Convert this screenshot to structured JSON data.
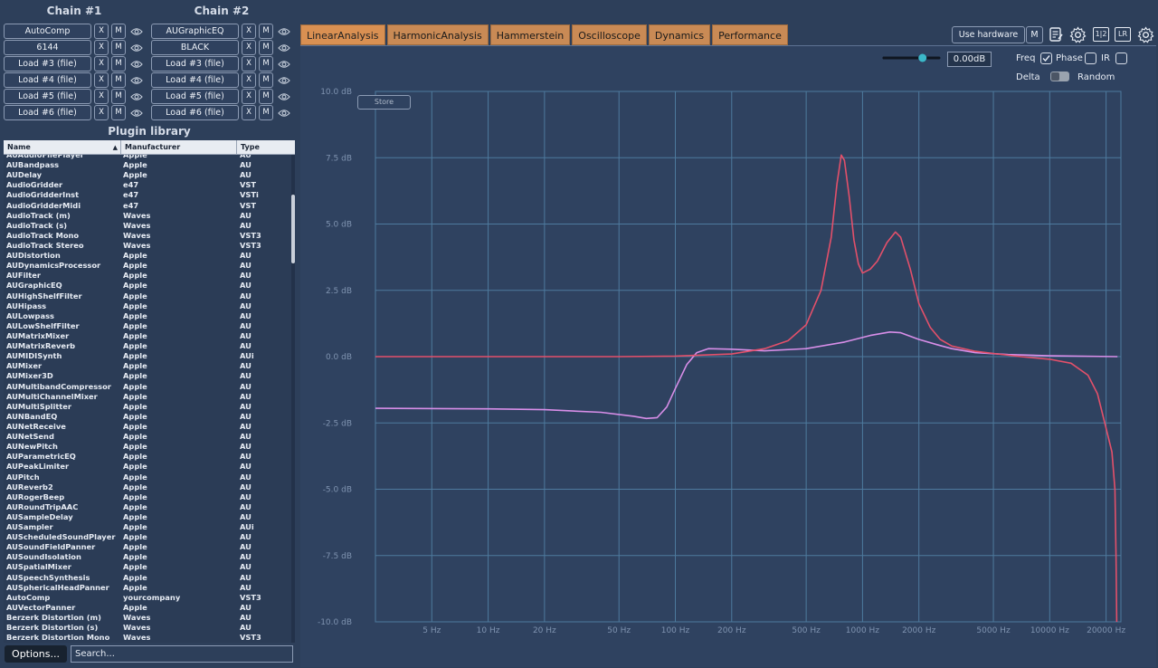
{
  "chains": [
    {
      "title": "Chain #1",
      "slots": [
        "AutoComp",
        "6144",
        "Load #3 (file)",
        "Load #4 (file)",
        "Load #5 (file)",
        "Load #6 (file)"
      ]
    },
    {
      "title": "Chain #2",
      "slots": [
        "AUGraphicEQ",
        "BLACK",
        "Load #3 (file)",
        "Load #4 (file)",
        "Load #5 (file)",
        "Load #6 (file)"
      ]
    }
  ],
  "slot_buttons": {
    "remove": "X",
    "mute": "M",
    "view_icon": "eye-icon"
  },
  "library": {
    "title": "Plugin library",
    "columns": [
      "Name",
      "Manufacturer",
      "Type"
    ],
    "rows": [
      [
        "AUAudioFilePlayer",
        "Apple",
        "AU"
      ],
      [
        "AUBandpass",
        "Apple",
        "AU"
      ],
      [
        "AUDelay",
        "Apple",
        "AU"
      ],
      [
        "AudioGridder",
        "e47",
        "VST"
      ],
      [
        "AudioGridderInst",
        "e47",
        "VSTi"
      ],
      [
        "AudioGridderMidi",
        "e47",
        "VST"
      ],
      [
        "AudioTrack (m)",
        "Waves",
        "AU"
      ],
      [
        "AudioTrack (s)",
        "Waves",
        "AU"
      ],
      [
        "AudioTrack Mono",
        "Waves",
        "VST3"
      ],
      [
        "AudioTrack Stereo",
        "Waves",
        "VST3"
      ],
      [
        "AUDistortion",
        "Apple",
        "AU"
      ],
      [
        "AUDynamicsProcessor",
        "Apple",
        "AU"
      ],
      [
        "AUFilter",
        "Apple",
        "AU"
      ],
      [
        "AUGraphicEQ",
        "Apple",
        "AU"
      ],
      [
        "AUHighShelfFilter",
        "Apple",
        "AU"
      ],
      [
        "AUHipass",
        "Apple",
        "AU"
      ],
      [
        "AULowpass",
        "Apple",
        "AU"
      ],
      [
        "AULowShelfFilter",
        "Apple",
        "AU"
      ],
      [
        "AUMatrixMixer",
        "Apple",
        "AU"
      ],
      [
        "AUMatrixReverb",
        "Apple",
        "AU"
      ],
      [
        "AUMIDISynth",
        "Apple",
        "AUi"
      ],
      [
        "AUMixer",
        "Apple",
        "AU"
      ],
      [
        "AUMixer3D",
        "Apple",
        "AU"
      ],
      [
        "AUMultibandCompressor",
        "Apple",
        "AU"
      ],
      [
        "AUMultiChannelMixer",
        "Apple",
        "AU"
      ],
      [
        "AUMultiSplitter",
        "Apple",
        "AU"
      ],
      [
        "AUNBandEQ",
        "Apple",
        "AU"
      ],
      [
        "AUNetReceive",
        "Apple",
        "AU"
      ],
      [
        "AUNetSend",
        "Apple",
        "AU"
      ],
      [
        "AUNewPitch",
        "Apple",
        "AU"
      ],
      [
        "AUParametricEQ",
        "Apple",
        "AU"
      ],
      [
        "AUPeakLimiter",
        "Apple",
        "AU"
      ],
      [
        "AUPitch",
        "Apple",
        "AU"
      ],
      [
        "AUReverb2",
        "Apple",
        "AU"
      ],
      [
        "AURogerBeep",
        "Apple",
        "AU"
      ],
      [
        "AURoundTripAAC",
        "Apple",
        "AU"
      ],
      [
        "AUSampleDelay",
        "Apple",
        "AU"
      ],
      [
        "AUSampler",
        "Apple",
        "AUi"
      ],
      [
        "AUScheduledSoundPlayer",
        "Apple",
        "AU"
      ],
      [
        "AUSoundFieldPanner",
        "Apple",
        "AU"
      ],
      [
        "AUSoundIsolation",
        "Apple",
        "AU"
      ],
      [
        "AUSpatialMixer",
        "Apple",
        "AU"
      ],
      [
        "AUSpeechSynthesis",
        "Apple",
        "AU"
      ],
      [
        "AUSphericalHeadPanner",
        "Apple",
        "AU"
      ],
      [
        "AutoComp",
        "yourcompany",
        "VST3"
      ],
      [
        "AUVectorPanner",
        "Apple",
        "AU"
      ],
      [
        "Berzerk Distortion (m)",
        "Waves",
        "AU"
      ],
      [
        "Berzerk Distortion (s)",
        "Waves",
        "AU"
      ],
      [
        "Berzerk Distortion Mono",
        "Waves",
        "VST3"
      ]
    ]
  },
  "bottom": {
    "options_label": "Options...",
    "search_placeholder": "Search..."
  },
  "tabs": [
    "LinearAnalysis",
    "HarmonicAnalysis",
    "Hammerstein",
    "Oscilloscope",
    "Dynamics",
    "Performance"
  ],
  "active_tab": "LinearAnalysis",
  "toolbar": {
    "use_hardware_label": "Use hardware",
    "m_label": "M",
    "stereo_icon_label": "1|2",
    "lr_icon_label": "LR",
    "icons": [
      "notes-icon",
      "gear-icon",
      "channels-icon",
      "lr-icon",
      "settings-gear-icon"
    ]
  },
  "controls": {
    "gain_value": "0.00dB",
    "gain_level": 0.7,
    "freq_label": "Freq",
    "freq_checked": true,
    "phase_label": "Phase",
    "phase_checked": false,
    "ir_label": "IR",
    "ir_checked": false,
    "delta_label": "Delta",
    "delta_on": false,
    "random_label": "Random",
    "store_label": "Store"
  },
  "colors": {
    "background": "#2d3f5a",
    "plot_background": "#2f4260",
    "grid": "#4e7a9e",
    "tab": "#c98a55",
    "accent": "#3bb8c9",
    "curve_magnitude": "#e3506a",
    "curve_phase": "#d88ee8"
  },
  "chart_data": {
    "type": "line",
    "xscale": "log",
    "xlim": [
      2.5,
      24000
    ],
    "ylim": [
      -10,
      10
    ],
    "x_ticks": [
      {
        "value": 5,
        "label": "5 Hz"
      },
      {
        "value": 10,
        "label": "10 Hz"
      },
      {
        "value": 20,
        "label": "20 Hz"
      },
      {
        "value": 50,
        "label": "50 Hz"
      },
      {
        "value": 100,
        "label": "100 Hz"
      },
      {
        "value": 200,
        "label": "200 Hz"
      },
      {
        "value": 500,
        "label": "500 Hz"
      },
      {
        "value": 1000,
        "label": "1000 Hz"
      },
      {
        "value": 2000,
        "label": "2000 Hz"
      },
      {
        "value": 5000,
        "label": "5000 Hz"
      },
      {
        "value": 10000,
        "label": "10000 Hz"
      },
      {
        "value": 20000,
        "label": "20000 Hz"
      }
    ],
    "y_ticks": [
      {
        "value": 10,
        "label": "10.0 dB"
      },
      {
        "value": 7.5,
        "label": "7.5 dB"
      },
      {
        "value": 5,
        "label": "5.0 dB"
      },
      {
        "value": 2.5,
        "label": "2.5 dB"
      },
      {
        "value": 0,
        "label": "0.0 dB"
      },
      {
        "value": -2.5,
        "label": "-2.5 dB"
      },
      {
        "value": -5,
        "label": "-5.0 dB"
      },
      {
        "value": -7.5,
        "label": "-7.5 dB"
      },
      {
        "value": -10,
        "label": "-10.0 dB"
      }
    ],
    "grid": true,
    "series": [
      {
        "color": "#e3506a",
        "points": [
          [
            2.5,
            0.0
          ],
          [
            50,
            0.0
          ],
          [
            100,
            0.02
          ],
          [
            200,
            0.1
          ],
          [
            300,
            0.3
          ],
          [
            400,
            0.6
          ],
          [
            500,
            1.2
          ],
          [
            600,
            2.5
          ],
          [
            680,
            4.5
          ],
          [
            730,
            6.5
          ],
          [
            770,
            7.6
          ],
          [
            800,
            7.4
          ],
          [
            850,
            6.0
          ],
          [
            900,
            4.4
          ],
          [
            950,
            3.5
          ],
          [
            1000,
            3.15
          ],
          [
            1100,
            3.3
          ],
          [
            1200,
            3.6
          ],
          [
            1350,
            4.3
          ],
          [
            1500,
            4.7
          ],
          [
            1600,
            4.5
          ],
          [
            1800,
            3.3
          ],
          [
            2000,
            2.0
          ],
          [
            2300,
            1.1
          ],
          [
            2600,
            0.65
          ],
          [
            3000,
            0.4
          ],
          [
            4000,
            0.2
          ],
          [
            5000,
            0.12
          ],
          [
            7000,
            0.0
          ],
          [
            10000,
            -0.1
          ],
          [
            13000,
            -0.25
          ],
          [
            16000,
            -0.7
          ],
          [
            18000,
            -1.4
          ],
          [
            20000,
            -2.7
          ],
          [
            21500,
            -3.6
          ],
          [
            22300,
            -5.0
          ],
          [
            22600,
            -7.5
          ],
          [
            22800,
            -10.0
          ]
        ]
      },
      {
        "color": "#d88ee8",
        "points": [
          [
            2.5,
            -1.95
          ],
          [
            10,
            -1.97
          ],
          [
            20,
            -2.0
          ],
          [
            40,
            -2.1
          ],
          [
            60,
            -2.25
          ],
          [
            70,
            -2.33
          ],
          [
            80,
            -2.3
          ],
          [
            90,
            -1.9
          ],
          [
            100,
            -1.2
          ],
          [
            115,
            -0.3
          ],
          [
            130,
            0.15
          ],
          [
            150,
            0.3
          ],
          [
            200,
            0.28
          ],
          [
            300,
            0.22
          ],
          [
            500,
            0.3
          ],
          [
            800,
            0.55
          ],
          [
            1100,
            0.8
          ],
          [
            1400,
            0.93
          ],
          [
            1600,
            0.9
          ],
          [
            2000,
            0.65
          ],
          [
            2500,
            0.45
          ],
          [
            3000,
            0.3
          ],
          [
            4000,
            0.15
          ],
          [
            6000,
            0.08
          ],
          [
            10000,
            0.03
          ],
          [
            23000,
            0.0
          ]
        ]
      }
    ]
  }
}
